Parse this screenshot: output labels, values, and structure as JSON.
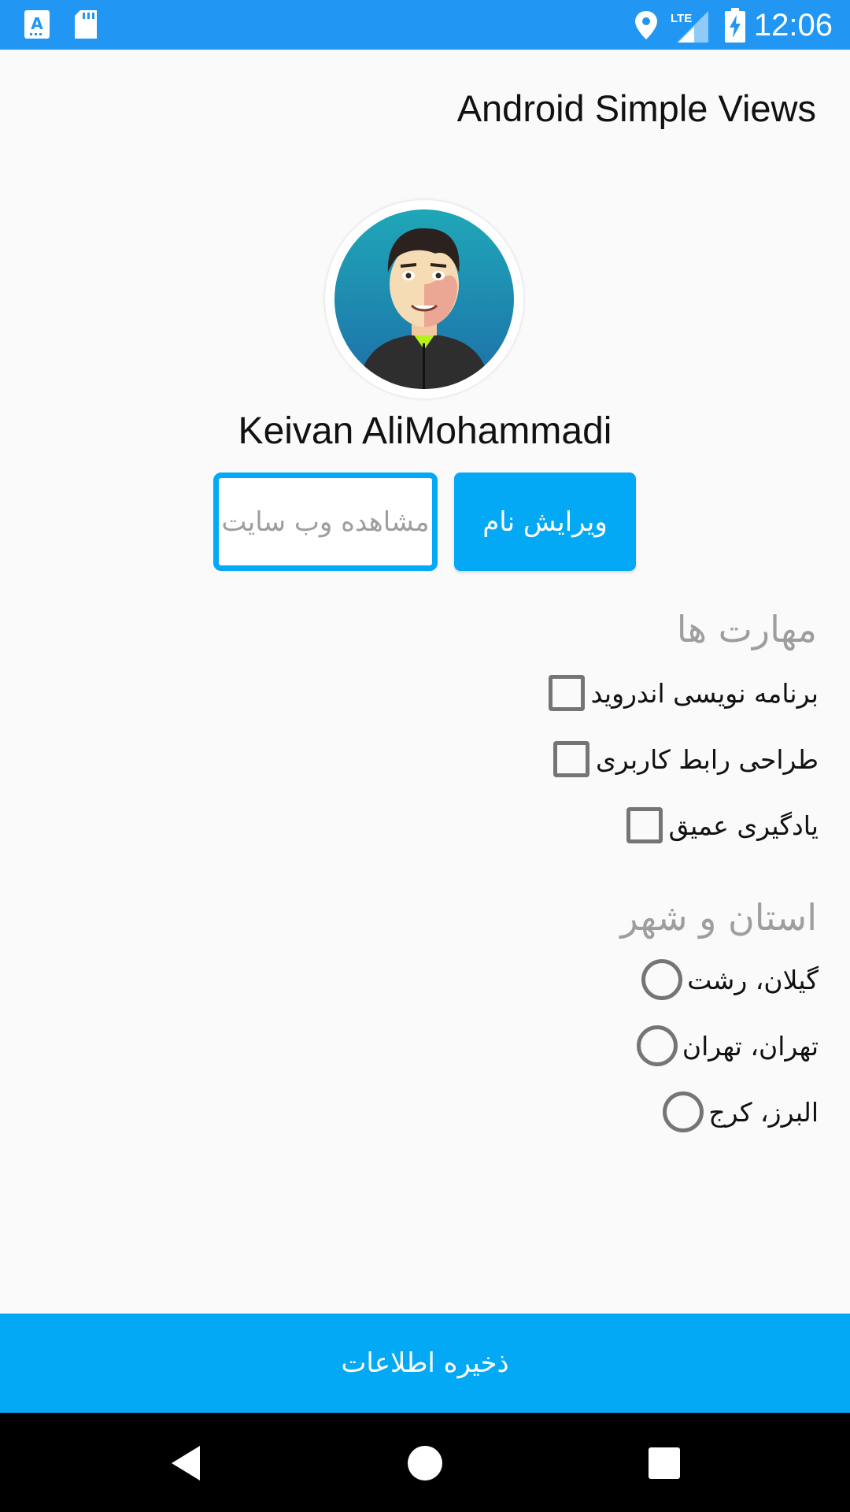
{
  "status_bar": {
    "time": "12:06",
    "network": "LTE",
    "icons": [
      "app-a-icon",
      "sd-card-icon",
      "location-icon",
      "signal-icon",
      "battery-charging-icon"
    ]
  },
  "app_bar": {
    "title": "Android Simple Views"
  },
  "profile": {
    "name": "Keivan AliMohammadi"
  },
  "actions": {
    "view_website": "مشاهده وب سایت",
    "edit_name": "ویرایش نام"
  },
  "skills": {
    "title": "مهارت ها",
    "items": [
      {
        "label": "برنامه نویسی اندروید",
        "checked": false
      },
      {
        "label": "طراحی رابط کاربری",
        "checked": false
      },
      {
        "label": "یادگیری عمیق",
        "checked": false
      }
    ]
  },
  "location": {
    "title": "استان و شهر",
    "options": [
      {
        "label": "گیلان، رشت",
        "selected": false
      },
      {
        "label": "تهران، تهران",
        "selected": false
      },
      {
        "label": "البرز، کرج",
        "selected": false
      }
    ]
  },
  "save_button": "ذخیره اطلاعات",
  "colors": {
    "status_bar": "#2196f3",
    "accent": "#03a9f4",
    "nav_bar": "#000000"
  }
}
